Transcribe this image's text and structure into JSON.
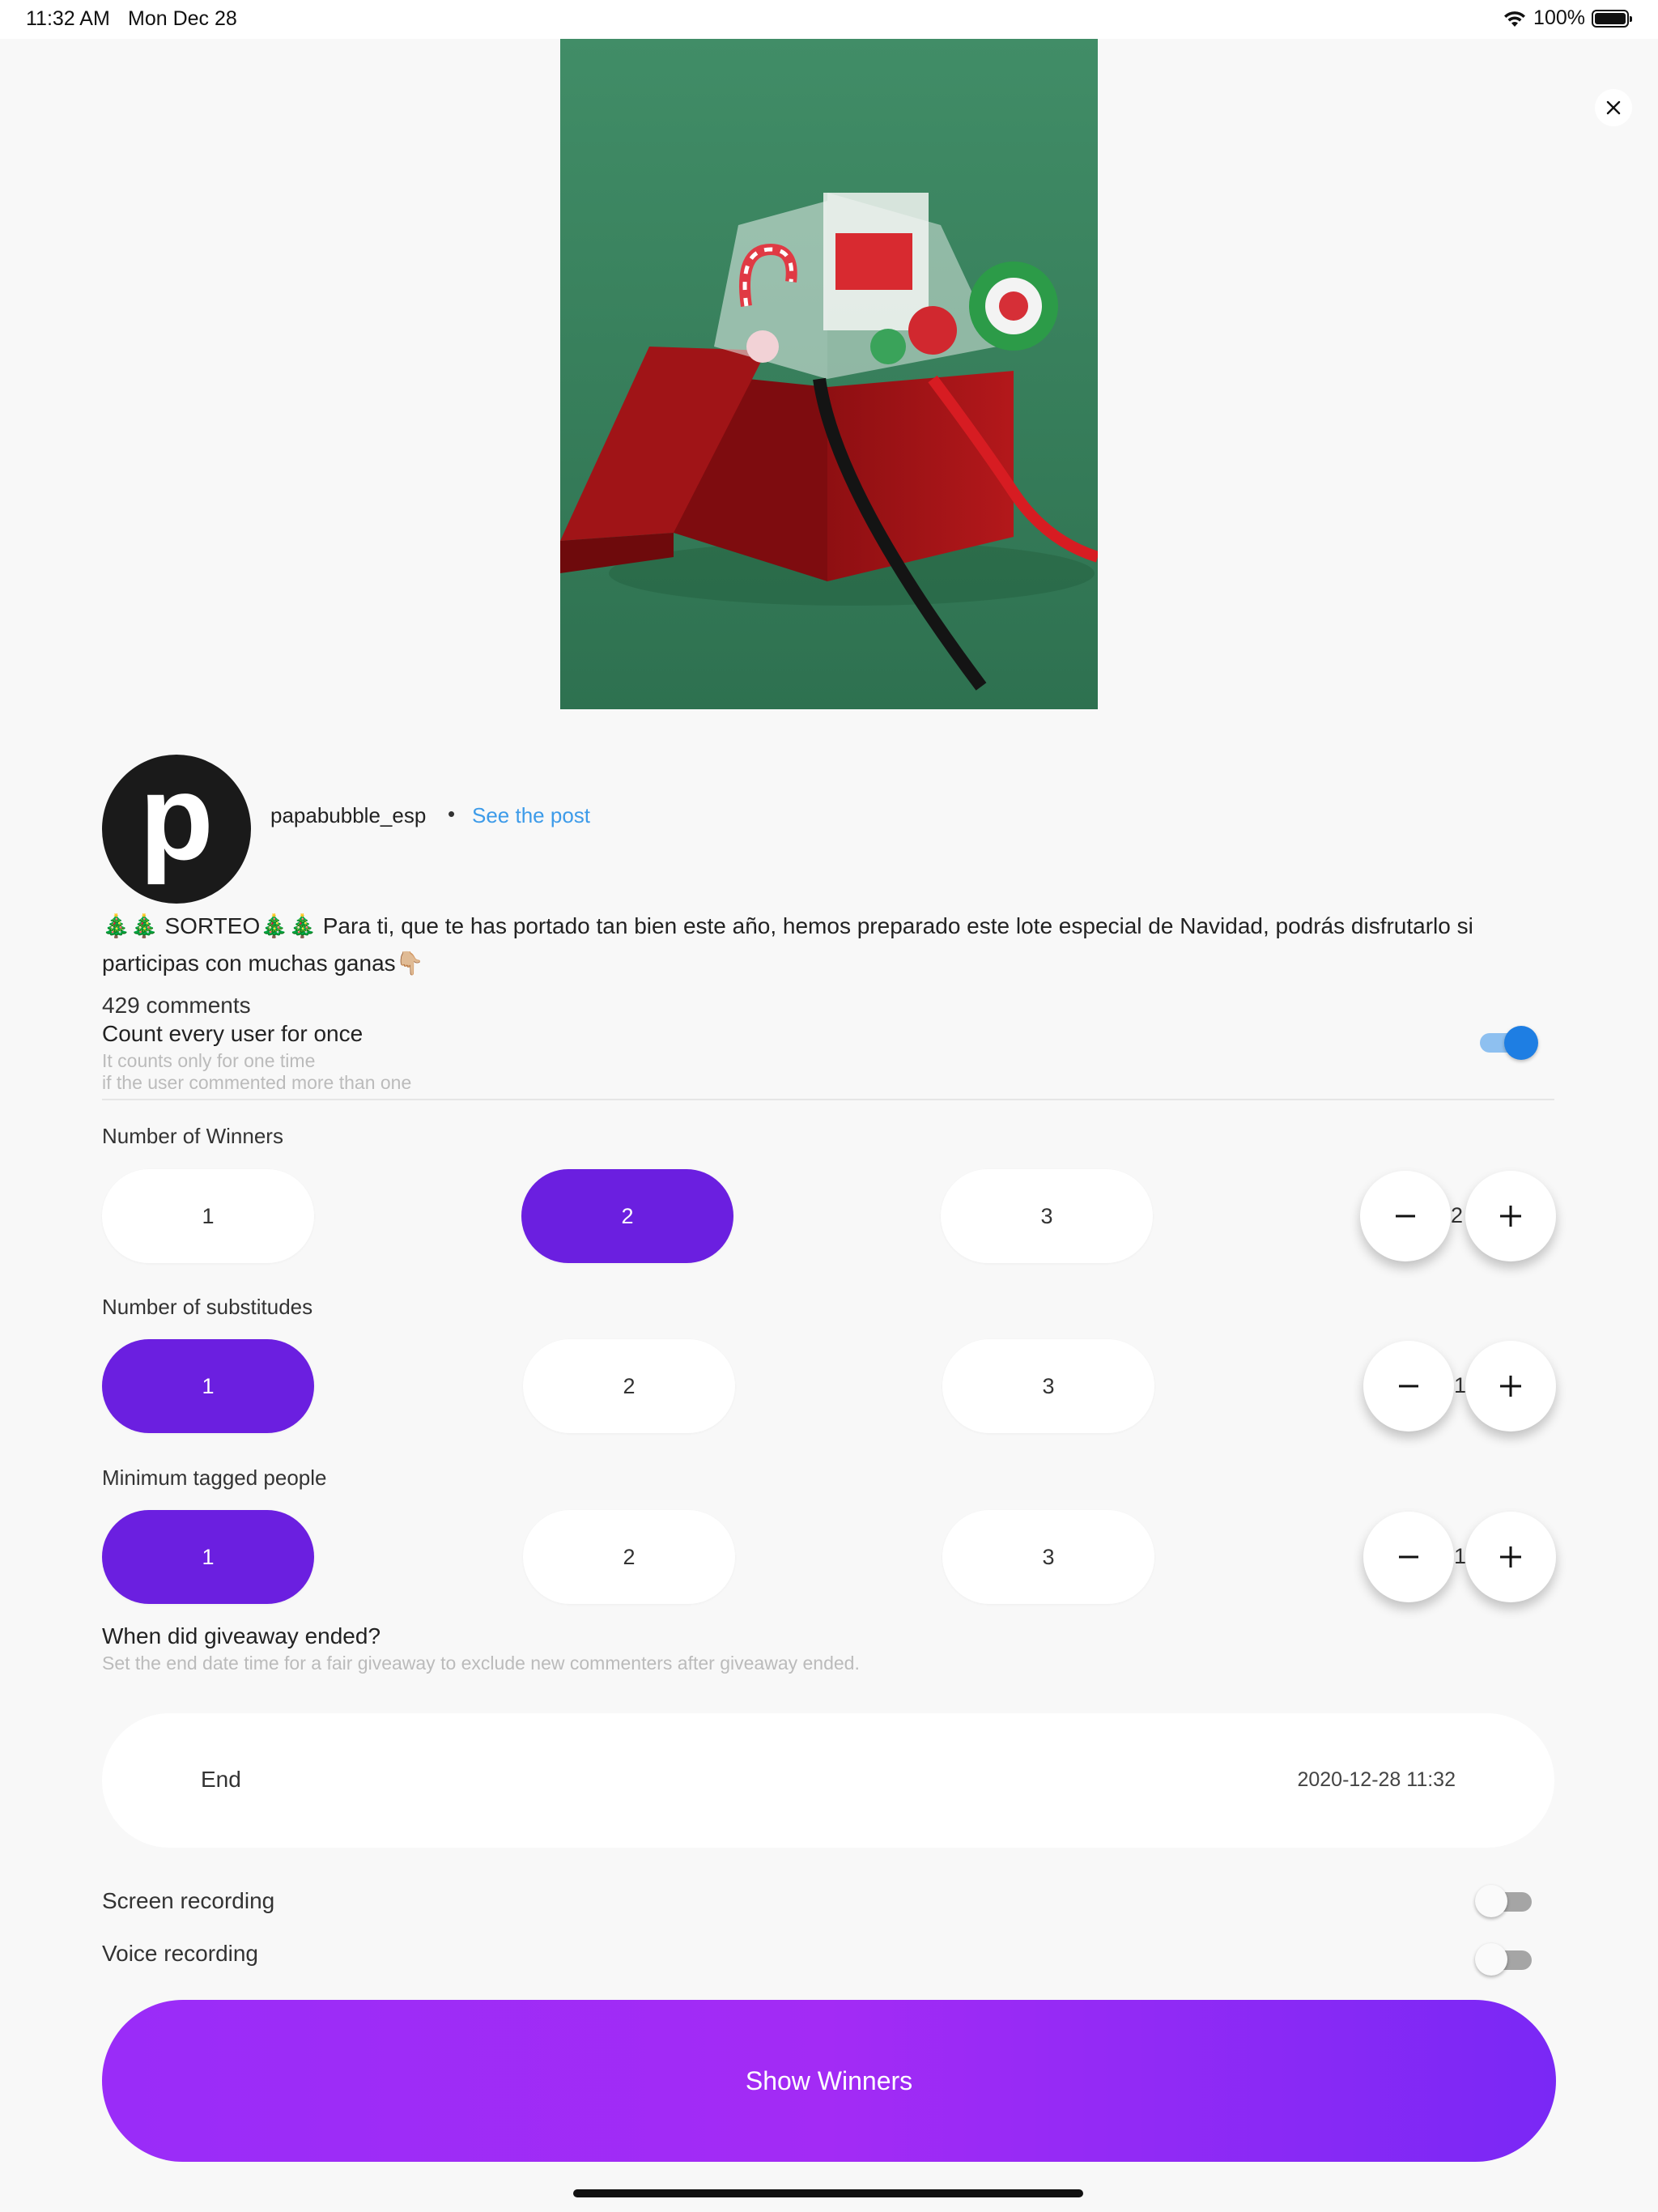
{
  "status_bar": {
    "time": "11:32 AM",
    "date": "Mon Dec 28",
    "battery": "100%"
  },
  "post": {
    "avatar_letter": "p",
    "username": "papabubble_esp",
    "separator": "•",
    "see_post_label": "See the post",
    "caption": "🎄🎄 SORTEO🎄🎄 Para ti, que te has portado tan bien este año, hemos preparado este lote especial de Navidad, podrás disfrutarlo si participas con muchas ganas👇🏼",
    "comments": "429 comments"
  },
  "count_once": {
    "title": "Count every user for once",
    "subtitle_1": "It counts only for one time",
    "subtitle_2": "if the user commented more than one",
    "enabled": true
  },
  "winners": {
    "label": "Number of Winners",
    "options": [
      "1",
      "2",
      "3"
    ],
    "selected": "2",
    "value": "2"
  },
  "substitutes": {
    "label": "Number of substitudes",
    "options": [
      "1",
      "2",
      "3"
    ],
    "selected": "1",
    "value": "1"
  },
  "tagged": {
    "label": "Minimum tagged people",
    "options": [
      "1",
      "2",
      "3"
    ],
    "selected": "1",
    "value": "1"
  },
  "giveaway_end": {
    "title": "When did giveaway ended?",
    "subtitle": "Set the end date time for a fair giveaway to exclude new commenters after giveaway ended.",
    "end_label": "End",
    "end_value": "2020-12-28 11:32"
  },
  "recording": {
    "screen_label": "Screen recording",
    "screen_enabled": false,
    "voice_label": "Voice recording",
    "voice_enabled": false
  },
  "show_winners_label": "Show Winners",
  "colors": {
    "accent": "#6b1fe0",
    "link": "#3d9be9",
    "toggle_on": "#1e7ee3",
    "button_gradient_start": "#9a2cf8",
    "button_gradient_end": "#7a28f5"
  },
  "icons": {
    "close": "close-icon",
    "minus": "minus-icon",
    "plus": "plus-icon",
    "wifi": "wifi-icon",
    "battery": "battery-icon"
  }
}
